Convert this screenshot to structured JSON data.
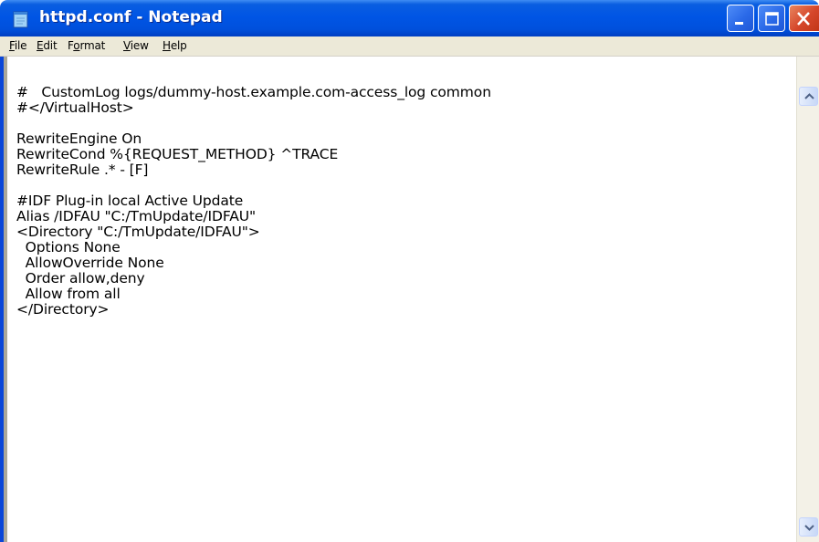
{
  "window": {
    "title": "httpd.conf - Notepad",
    "icons": {
      "app": "notepad-icon",
      "minimize": "minimize-icon",
      "maximize": "maximize-icon",
      "close": "close-icon"
    }
  },
  "menu": {
    "file": {
      "ul": "F",
      "rest": "ile"
    },
    "edit": {
      "ul": "E",
      "rest": "dit"
    },
    "format": {
      "pre": "F",
      "ul": "o",
      "rest": "rmat"
    },
    "view": {
      "ul": "V",
      "rest": "iew"
    },
    "help": {
      "ul": "H",
      "rest": "elp"
    }
  },
  "editor": {
    "lines": [
      "#   CustomLog logs/dummy-host.example.com-access_log common",
      "#</VirtualHost>",
      "",
      "RewriteEngine On",
      "RewriteCond %{REQUEST_METHOD} ^TRACE",
      "RewriteRule .* - [F]",
      "",
      "#IDF Plug-in local Active Update",
      "Alias /IDFAU \"C:/TmUpdate/IDFAU\"",
      "<Directory \"C:/TmUpdate/IDFAU\">",
      "  Options None",
      "  AllowOverride None",
      "  Order allow,deny",
      "  Allow from all",
      "</Directory>"
    ]
  },
  "scrollbar": {
    "up_icon": "scroll-up-arrow-icon",
    "down_icon": "scroll-down-arrow-icon"
  },
  "colors": {
    "titlebar": "#0055e5",
    "close_button": "#d5462a",
    "menubar": "#ece9d8"
  }
}
